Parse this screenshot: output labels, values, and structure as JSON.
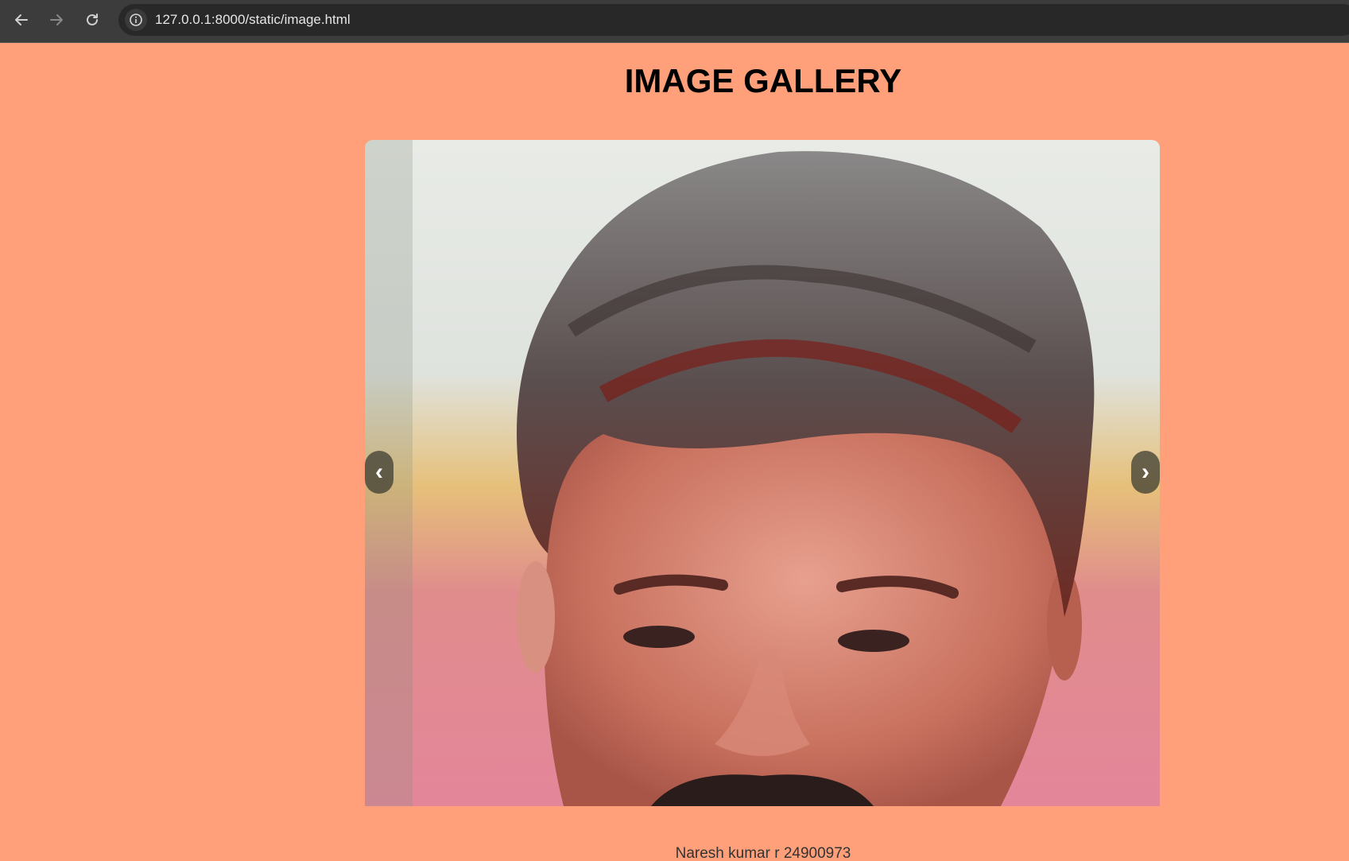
{
  "browser": {
    "url": "127.0.0.1:8000/static/image.html",
    "icons": {
      "back": "arrow-left-icon",
      "forward": "arrow-right-icon",
      "reload": "reload-icon",
      "site_info": "info-icon"
    }
  },
  "page": {
    "title": "IMAGE GALLERY",
    "background_color": "#ffa07a"
  },
  "gallery": {
    "prev_label": "‹",
    "next_label": "›",
    "caption": "Naresh kumar r 24900973"
  }
}
